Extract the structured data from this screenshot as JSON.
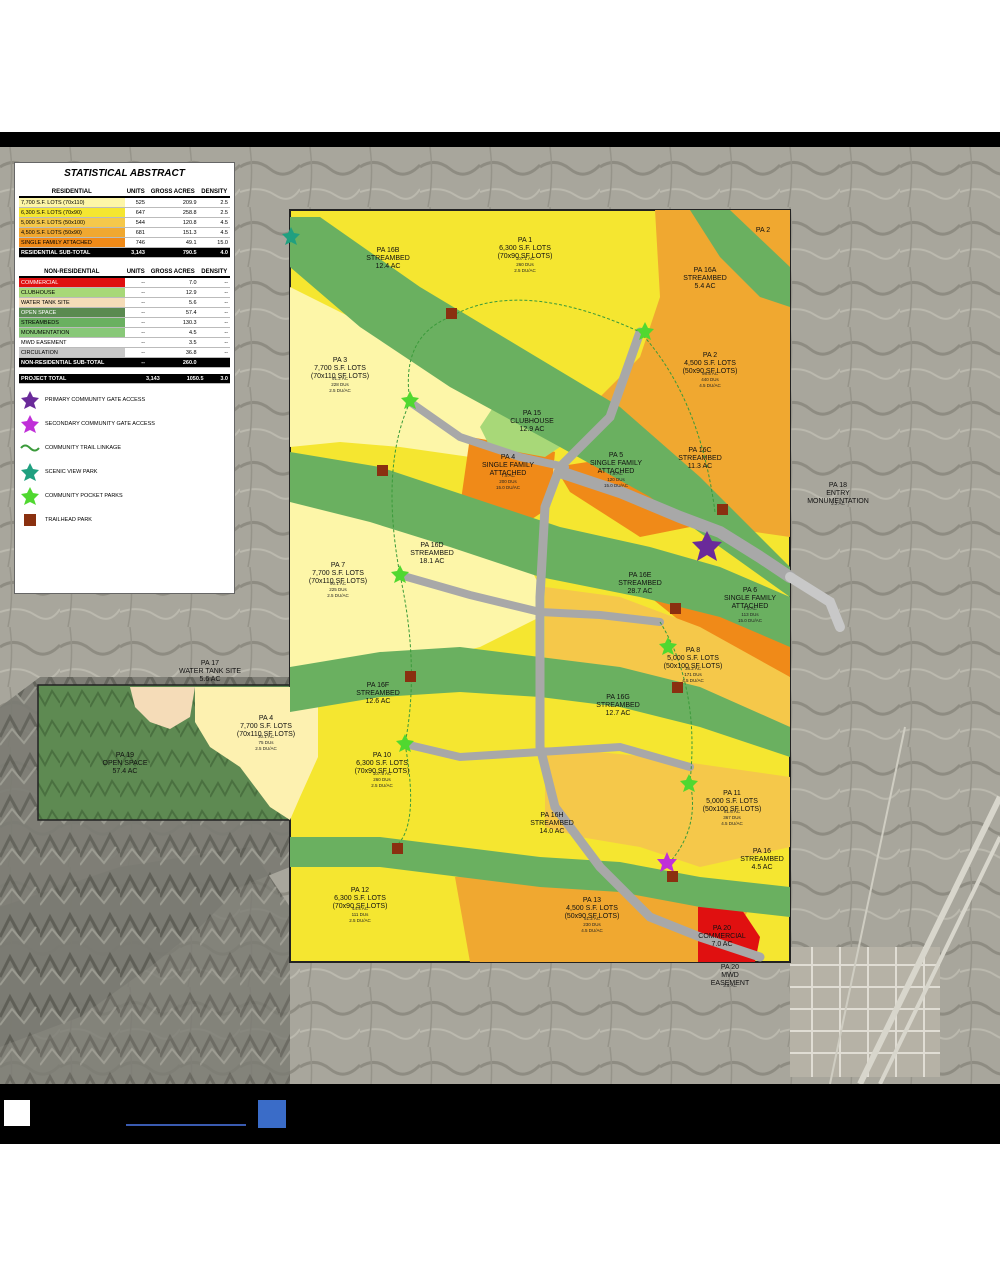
{
  "legend": {
    "title": "STATISTICAL ABSTRACT",
    "residential_header": {
      "col1": "RESIDENTIAL",
      "col2": "UNITS",
      "col3": "GROSS ACRES",
      "col4": "DENSITY"
    },
    "residential_rows": [
      {
        "label": "7,700 S.F. LOTS (70x110)",
        "units": "525",
        "acres": "209.9",
        "density": "2.5",
        "color": "#fdf6a8"
      },
      {
        "label": "6,300 S.F. LOTS (70x90)",
        "units": "647",
        "acres": "258.8",
        "density": "2.5",
        "color": "#f5e630"
      },
      {
        "label": "5,000 S.F. LOTS (50x100)",
        "units": "544",
        "acres": "120.8",
        "density": "4.5",
        "color": "#f5c84a"
      },
      {
        "label": "4,500 S.F. LOTS (50x90)",
        "units": "681",
        "acres": "151.3",
        "density": "4.5",
        "color": "#f0a830"
      },
      {
        "label": "SINGLE FAMILY ATTACHED",
        "units": "746",
        "acres": "49.1",
        "density": "15.0",
        "color": "#f08a18"
      }
    ],
    "residential_subtotal": {
      "label": "RESIDENTIAL SUB-TOTAL",
      "units": "3,143",
      "acres": "790.5",
      "density": "4.0"
    },
    "nonres_header": {
      "col1": "NON-RESIDENTIAL",
      "col2": "UNITS",
      "col3": "GROSS ACRES",
      "col4": "DENSITY"
    },
    "nonres_rows": [
      {
        "label": "COMMERCIAL",
        "units": "--",
        "acres": "7.0",
        "density": "--",
        "color": "#e01010"
      },
      {
        "label": "CLUBHOUSE",
        "units": "--",
        "acres": "12.9",
        "density": "--",
        "color": "#a8d878"
      },
      {
        "label": "WATER TANK SITE",
        "units": "--",
        "acres": "5.6",
        "density": "--",
        "color": "#f5dcb8"
      },
      {
        "label": "OPEN SPACE",
        "units": "--",
        "acres": "57.4",
        "density": "--",
        "color": "#5a8a50"
      },
      {
        "label": "STREAMBEDS",
        "units": "--",
        "acres": "130.3",
        "density": "--",
        "color": "#6ab060"
      },
      {
        "label": "MONUMENTATION",
        "units": "--",
        "acres": "4.5",
        "density": "--",
        "color": "#88c878"
      },
      {
        "label": "MWD EASEMENT",
        "units": "--",
        "acres": "3.5",
        "density": "--",
        "color": "#ffffff"
      },
      {
        "label": "CIRCULATION",
        "units": "--",
        "acres": "36.8",
        "density": "--",
        "color": "#c8c8c8"
      }
    ],
    "nonres_subtotal": {
      "label": "NON-RESIDENTIAL SUB-TOTAL",
      "units": "--",
      "acres": "260.0",
      "density": ""
    },
    "project_total": {
      "label": "PROJECT TOTAL",
      "units": "3,143",
      "acres": "1050.5",
      "density": "3.0"
    },
    "symbols": [
      {
        "label": "PRIMARY COMMUNITY GATE ACCESS",
        "icon": "primary-gate-icon",
        "color": "#6a2a9a"
      },
      {
        "label": "SECONDARY COMMUNITY GATE ACCESS",
        "icon": "secondary-gate-icon",
        "color": "#c030d8"
      },
      {
        "label": "COMMUNITY TRAIL LINKAGE",
        "icon": "trail-linkage-icon",
        "color": "#3a9a3a"
      },
      {
        "label": "SCENIC VIEW PARK",
        "icon": "scenic-park-icon",
        "color": "#20a080"
      },
      {
        "label": "COMMUNITY POCKET PARKS",
        "icon": "pocket-park-icon",
        "color": "#50d830"
      },
      {
        "label": "TRAILHEAD PARK",
        "icon": "trailhead-icon",
        "color": "#8a3010"
      }
    ]
  },
  "map_labels": {
    "pa1": [
      "PA 1",
      "6,300 S.F. LOTS",
      "(70x90 SF LOTS)",
      "107.1 AC",
      "260 DUs",
      "2.5 DU/AC"
    ],
    "pa1b": [
      "PA 16B",
      "STREAMBED",
      "12.4 AC"
    ],
    "pa2": [
      "PA 2"
    ],
    "pa16a": [
      "PA 16A",
      "STREAMBED",
      "5.4 AC"
    ],
    "pa2b": [
      "PA 2",
      "4,500 S.F. LOTS",
      "(50x90 SF LOTS)",
      "98.5 AC",
      "440 DUs",
      "4.5 DU/AC"
    ],
    "pa3": [
      "PA 3",
      "7,700 S.F. LOTS",
      "(70x110 SF LOTS)",
      "91.2 AC",
      "228 DUs",
      "2.5 DU/AC"
    ],
    "pa15": [
      "PA 15",
      "CLUBHOUSE",
      "12.9 AC"
    ],
    "pa4": [
      "PA 4",
      "SINGLE FAMILY",
      "ATTACHED",
      "7.5 AC",
      "200 DUs",
      "15.0 DU/AC"
    ],
    "pa5": [
      "PA 5",
      "SINGLE FAMILY",
      "ATTACHED",
      "7.8 AC",
      "120 DUs",
      "15.0 DU/AC"
    ],
    "pa16c": [
      "PA 16C",
      "STREAMBED",
      "11.3 AC"
    ],
    "pa18": [
      "PA 18",
      "ENTRY",
      "MONUMENTATION",
      "2.2 AC"
    ],
    "pa7": [
      "PA 7",
      "7,700 S.F. LOTS",
      "(70x110 SF LOTS)",
      "90.1 AC",
      "225 DUs",
      "2.5 DU/AC"
    ],
    "pa16d": [
      "PA 16D",
      "STREAMBED",
      "18.1 AC"
    ],
    "pa16e": [
      "PA 16E",
      "STREAMBED",
      "28.7 AC"
    ],
    "pa6": [
      "PA 6",
      "SINGLE FAMILY",
      "ATTACHED",
      "7.6 AC",
      "113 DUs",
      "15.0 DU/AC"
    ],
    "pa8": [
      "PA 8",
      "5,000 S.F. LOTS",
      "(50x100 SF LOTS)",
      "38.2 AC",
      "171 DUs",
      "4.5 DU/AC"
    ],
    "pa17": [
      "PA 17",
      "WATER TANK SITE",
      "5.6 AC"
    ],
    "pa16f": [
      "PA 16F",
      "STREAMBED",
      "12.6 AC"
    ],
    "pa16g": [
      "PA 16G",
      "STREAMBED",
      "12.7 AC"
    ],
    "pa4b": [
      "PA 4",
      "7,700 S.F. LOTS",
      "(70x110 SF LOTS)",
      "30.1 AC",
      "75 DUs",
      "2.5 DU/AC"
    ],
    "pa19": [
      "PA 19",
      "OPEN SPACE",
      "57.4 AC"
    ],
    "pa10": [
      "PA 10",
      "6,300 S.F. LOTS",
      "(70x90 SF LOTS)",
      "107.5 AC",
      "260 DUs",
      "2.5 DU/AC"
    ],
    "pa11": [
      "PA 11",
      "5,000 S.F. LOTS",
      "(50x100 SF LOTS)",
      "81.6 AC",
      "367 DUs",
      "4.5 DU/AC"
    ],
    "pa16h": [
      "PA 16H",
      "STREAMBED",
      "14.0 AC"
    ],
    "pa16i": [
      "PA 16",
      "STREAMBED",
      "4.5 AC"
    ],
    "pa12": [
      "PA 12",
      "6,300 S.F. LOTS",
      "(70x90 SF LOTS)",
      "44.4 AC",
      "111 DUs",
      "2.5 DU/AC"
    ],
    "pa13": [
      "PA 13",
      "4,500 S.F. LOTS",
      "(50x90 SF LOTS)",
      "51.2 AC",
      "230 DUs",
      "4.5 DU/AC"
    ],
    "pa20": [
      "PA 20",
      "COMMERCIAL",
      "7.0 AC"
    ],
    "pa20b": [
      "PA 20",
      "MWD",
      "EASEMENT",
      "3.5 AC"
    ]
  }
}
